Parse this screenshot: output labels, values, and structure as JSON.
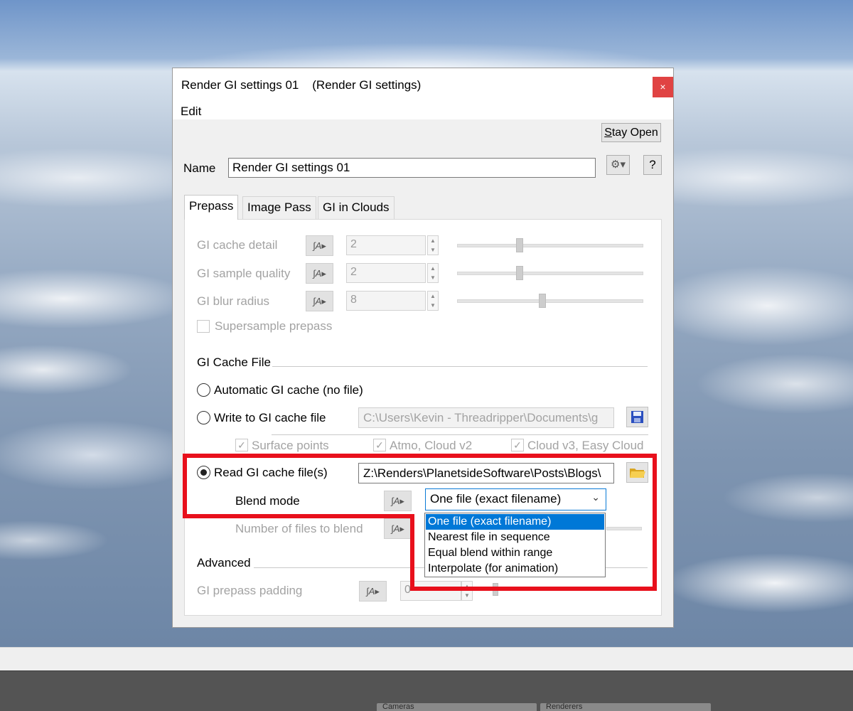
{
  "window": {
    "title": "Render GI settings 01    (Render GI settings)",
    "close_label": "×",
    "menu": [
      "Edit"
    ]
  },
  "toolbar": {
    "stay_open_prefix": "S",
    "stay_open_rest": "tay Open",
    "gear_glyph": "⚙▾",
    "help_label": "?"
  },
  "name_field": {
    "label": "Name",
    "value": "Render GI settings 01"
  },
  "tabs": [
    {
      "label": "Prepass",
      "active": true
    },
    {
      "label": "Image Pass",
      "active": false
    },
    {
      "label": "GI in Clouds",
      "active": false
    }
  ],
  "prepass": {
    "rows": [
      {
        "label": "GI cache detail",
        "value": "2",
        "slider": 0.45
      },
      {
        "label": "GI sample quality",
        "value": "2",
        "slider": 0.45
      },
      {
        "label": "GI blur radius",
        "value": "8",
        "slider": 0.6
      }
    ],
    "supersample_label": "Supersample prepass",
    "cache_group_label": "GI Cache File",
    "automatic_label": "Automatic GI cache (no file)",
    "write_label": "Write to GI cache file",
    "write_path": "C:\\Users\\Kevin - Threadripper\\Documents\\g",
    "checkboxes": [
      "Surface points",
      "Atmo, Cloud v2",
      "Cloud v3, Easy Cloud"
    ],
    "read_label": "Read GI cache file(s)",
    "read_path": "Z:\\Renders\\PlanetsideSoftware\\Posts\\Blogs\\",
    "blend_mode_label": "Blend mode",
    "blend_mode_value": "One file (exact filename)",
    "blend_options": [
      "One file (exact filename)",
      "Nearest file in sequence",
      "Equal blend within range",
      "Interpolate (for animation)"
    ],
    "num_files_label": "Number of files to blend",
    "advanced_label": "Advanced",
    "padding_label": "GI prepass padding",
    "padding_value": "0"
  },
  "anim_button_glyph": "∫A▸",
  "bottom_panels": [
    "Cameras",
    "Renderers"
  ],
  "colors": {
    "highlight": "#e8101c",
    "selection": "#0078d7",
    "close": "#e04343"
  }
}
